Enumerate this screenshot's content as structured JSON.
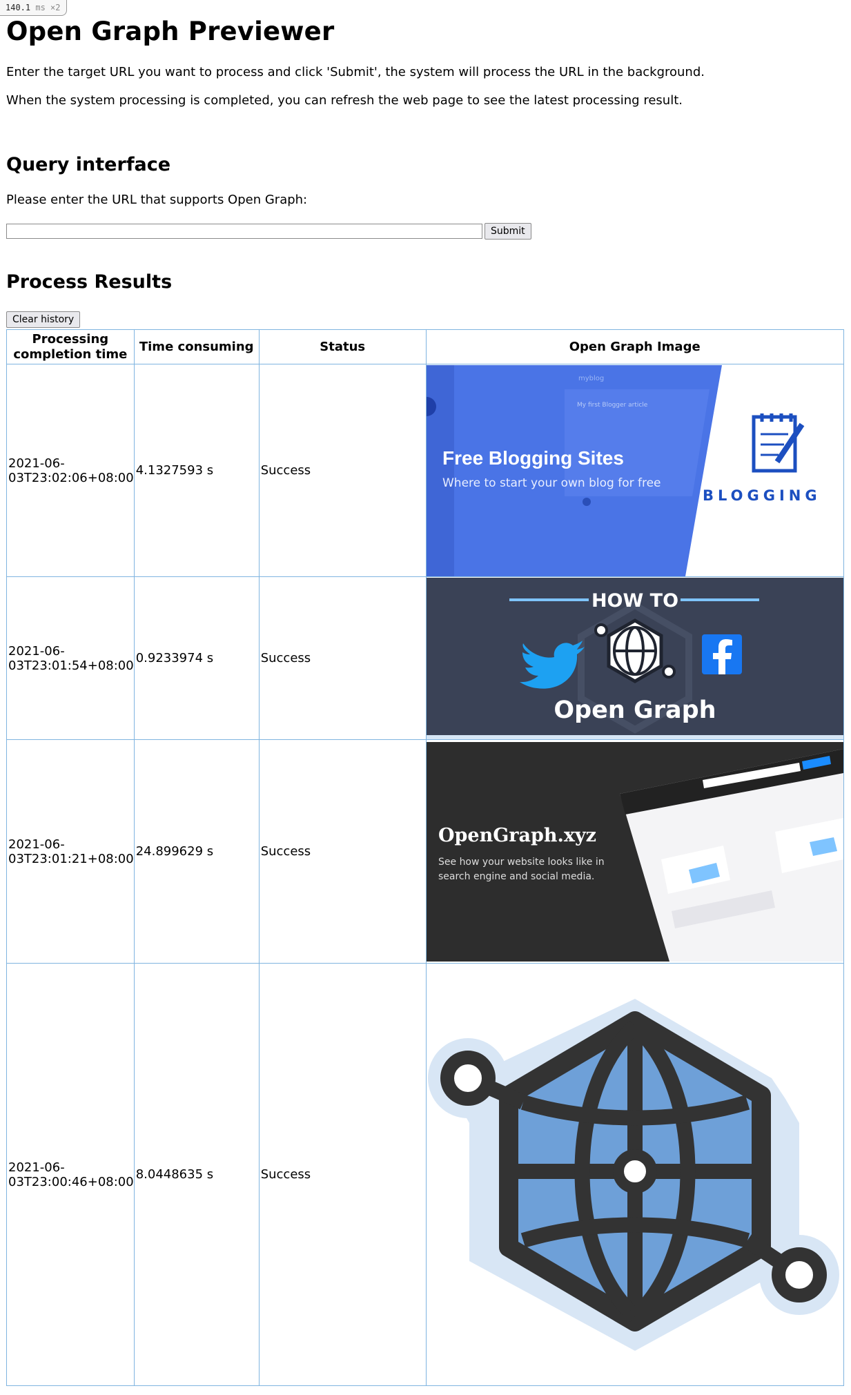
{
  "timing": {
    "value": "140.1",
    "unit": "ms",
    "mult": "×2"
  },
  "title": "Open Graph Previewer",
  "intro": [
    "Enter the target URL you want to process and click 'Submit', the system will process the URL in the background.",
    "When the system processing is completed, you can refresh the web page to see the latest processing result."
  ],
  "query": {
    "heading": "Query interface",
    "label": "Please enter the URL that supports Open Graph:",
    "input_value": "",
    "submit_label": "Submit"
  },
  "results": {
    "heading": "Process Results",
    "clear_label": "Clear history",
    "columns": [
      "Processing completion time",
      "Time consuming",
      "Status",
      "Open Graph Image"
    ],
    "rows": [
      {
        "time": "2021-06-03T23:02:06+08:00",
        "duration": "4.1327593 s",
        "status": "Success",
        "image": {
          "title": "Free Blogging Sites",
          "subtitle": "Where to start your own blog for free",
          "badge": "BLOGGING",
          "mock1": "myblog",
          "mock2": "My first Blogger article"
        }
      },
      {
        "time": "2021-06-03T23:01:54+08:00",
        "duration": "0.9233974 s",
        "status": "Success",
        "image": {
          "title": "HOW TO",
          "subtitle": "Open Graph"
        }
      },
      {
        "time": "2021-06-03T23:01:21+08:00",
        "duration": "24.899629 s",
        "status": "Success",
        "image": {
          "title": "OpenGraph.xyz",
          "subtitle_line1": "See how your website looks like in",
          "subtitle_line2": "search engine and social media."
        }
      },
      {
        "time": "2021-06-03T23:00:46+08:00",
        "duration": "8.0448635 s",
        "status": "Success",
        "image": {
          "title": "",
          "subtitle": ""
        }
      }
    ]
  }
}
